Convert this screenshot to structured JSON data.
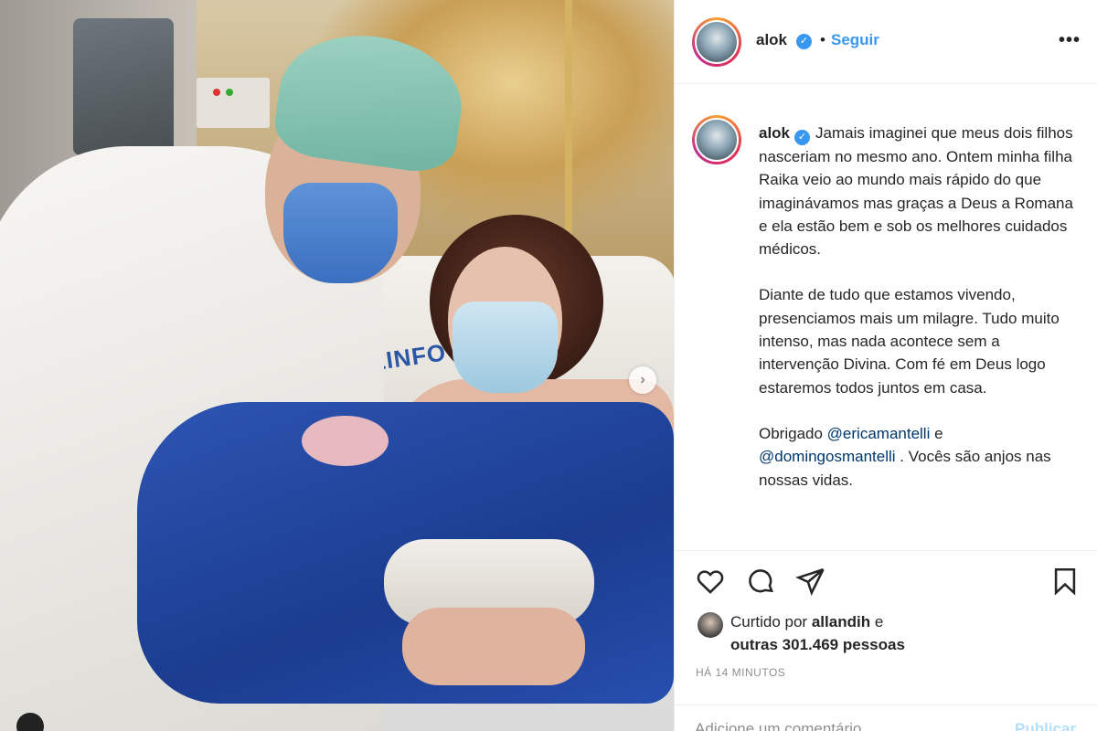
{
  "post": {
    "username": "alok",
    "verified_icon": "verified-badge-icon",
    "separator": "•",
    "follow_label": "Seguir",
    "more_label": "•••",
    "carousel_next": "›",
    "pillow_text": "ZINFOVS DR"
  },
  "caption": {
    "username": "alok",
    "paragraphs": [
      "Jamais imaginei que meus dois filhos nasceriam no mesmo ano. Ontem minha filha Raika veio ao mundo mais rápido do que imaginávamos mas graças a Deus a Romana e ela estão bem e sob os melhores cuidados médicos.",
      "Diante de tudo que estamos vivendo, presenciamos mais um milagre. Tudo muito intenso, mas nada acontece sem a intervenção Divina. Com fé em Deus logo estaremos todos juntos em casa."
    ],
    "thanks_prefix": "Obrigado",
    "mention_1": "@ericamantelli",
    "conjunction": "e",
    "mention_2": "@domingosmantelli",
    "thanks_suffix": ". Vocês são anjos nas nossas vidas."
  },
  "actions": {
    "like_icon": "heart-icon",
    "comment_icon": "comment-icon",
    "share_icon": "share-icon",
    "save_icon": "bookmark-icon"
  },
  "likes": {
    "prefix": "Curtido por",
    "user": "allandih",
    "connector": "e",
    "others": "outras 301.469 pessoas"
  },
  "timestamp": "HÁ 14 MINUTOS",
  "comment": {
    "placeholder": "Adicione um comentário...",
    "publish_label": "Publicar"
  },
  "colors": {
    "accent": "#3897f0",
    "mention": "#00376b",
    "muted": "#8e8e8e",
    "publish_disabled": "#b2dffc"
  }
}
